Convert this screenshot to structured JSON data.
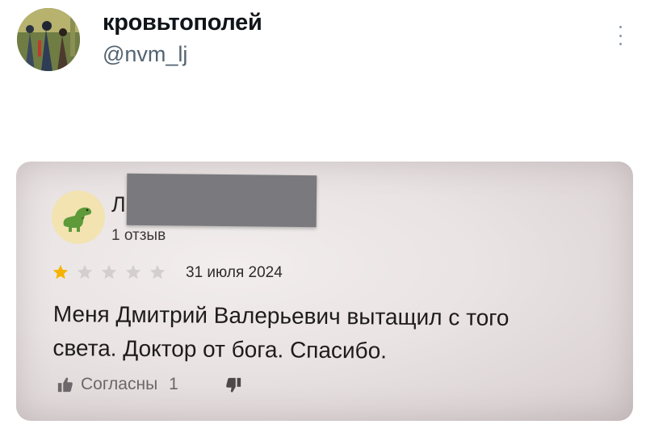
{
  "tweet": {
    "display_name": "кровьтополей",
    "handle": "@nvm_lj",
    "more_icon": "more-vertical-icon"
  },
  "review": {
    "reviewer_initial": "Л",
    "review_count": "1 отзыв",
    "rating": 1,
    "rating_max": 5,
    "date": "31 июля 2024",
    "text_lines": [
      "Меня Дмитрий Валерьевич вытащил с того",
      "света. Доктор от бога. Спасибо."
    ],
    "agree_label": "Согласны",
    "agree_count": "1",
    "colors": {
      "star_filled": "#f5b400",
      "star_empty": "#d4cfcf",
      "redaction": "#7a7a7e"
    }
  }
}
